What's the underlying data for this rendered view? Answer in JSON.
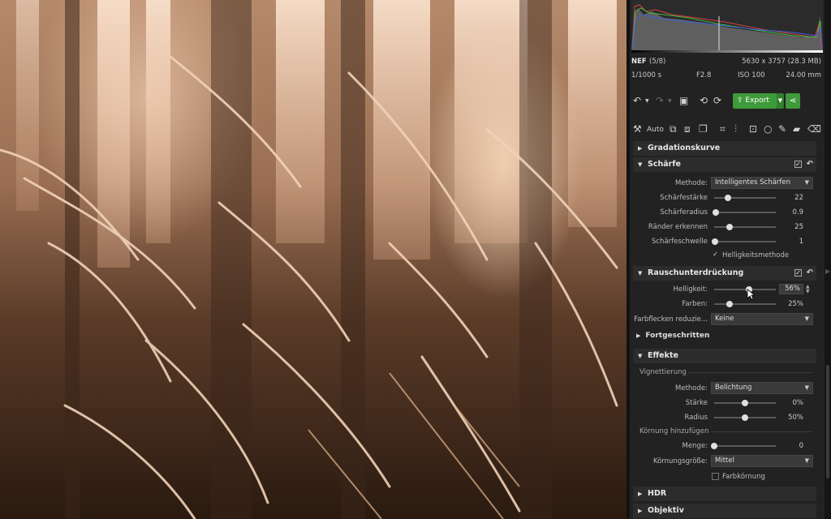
{
  "file_info": {
    "format": "NEF",
    "index": "(5/8)",
    "dimensions": "5630 x 3757 (28.3 MB)",
    "shutter": "1/1000 s",
    "aperture": "F2.8",
    "iso": "ISO 100",
    "focal_length": "24.00 mm"
  },
  "toolbar": {
    "export_label": "Export",
    "auto_label": "Auto"
  },
  "sections": {
    "gradation": "Gradationskurve",
    "sharpening": "Schärfe",
    "noise": "Rauschunterdrückung",
    "advanced": "Fortgeschritten",
    "effects": "Effekte",
    "hdr": "HDR",
    "lens": "Objektiv"
  },
  "sharpening": {
    "method_label": "Methode:",
    "method_value": "Intelligentes Schärfen",
    "strength_label": "Schärfestärke",
    "strength_value": "22",
    "strength_level": 0.22,
    "radius_label": "Schärferadius",
    "radius_value": "0.9",
    "radius_level": 0.02,
    "edges_label": "Ränder erkennen",
    "edges_value": "25",
    "edges_level": 0.25,
    "threshold_label": "Schärfeschwelle",
    "threshold_value": "1",
    "threshold_level": 0.01,
    "brightness_method_label": "Helligkeitsmethode",
    "brightness_method_checked": true
  },
  "noise": {
    "luminance_label": "Helligkeit:",
    "luminance_value": "56%",
    "luminance_level": 0.56,
    "color_label": "Farben:",
    "color_value": "25%",
    "color_level": 0.25,
    "spots_label": "Farbflecken reduzie...",
    "spots_value": "Keine"
  },
  "effects": {
    "vignette_group": "Vignettierung",
    "method_label": "Methode:",
    "method_value": "Belichtung",
    "strength_label": "Stärke",
    "strength_value": "0%",
    "strength_level": 0.5,
    "radius_label": "Radius",
    "radius_value": "50%",
    "radius_level": 0.5,
    "grain_group": "Körnung hinzufügen",
    "amount_label": "Menge:",
    "amount_value": "0",
    "amount_level": 0,
    "grain_size_label": "Körnungsgröße:",
    "grain_size_value": "Mittel",
    "color_grain_label": "Farbkörnung",
    "color_grain_checked": false
  },
  "colors": {
    "accent_green": "#3e9a3a",
    "panel_bg": "#222222",
    "section_bg": "#2c2c2c"
  }
}
